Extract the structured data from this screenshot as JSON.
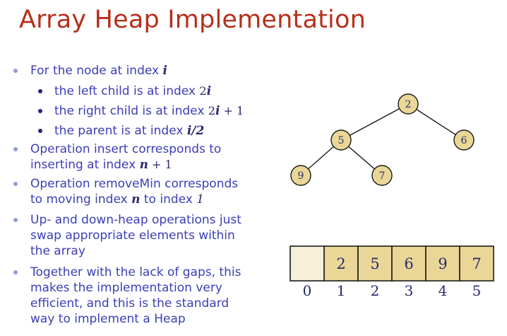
{
  "title": "Array Heap Implementation",
  "bullets": {
    "b1": {
      "text": "For the node at index ",
      "var": "i"
    },
    "sub1": {
      "text": "the left child is at index ",
      "expr": "2",
      "var": "i"
    },
    "sub2": {
      "text": "the right child is at index ",
      "expr": "2",
      "var": "i",
      "tail": " + 1"
    },
    "sub3": {
      "text": "the parent is at index ",
      "var": "i/2"
    },
    "b2_l1": "Operation insert corresponds to",
    "b2_l2": {
      "text": "inserting at index ",
      "var": "n",
      "tail": " + 1"
    },
    "b3_l1": "Operation removeMin corresponds",
    "b3_l2": {
      "text": "to  moving index ",
      "var": "n",
      "mid": " to index ",
      "num": "1"
    },
    "b4_l1": "Up- and down-heap operations just",
    "b4_l2": "swap appropriate elements within",
    "b4_l3": "the array",
    "b5_l1": "Together with the lack of gaps, this",
    "b5_l2": "makes the implementation very",
    "b5_l3": "efficient, and this is the standard",
    "b5_l4": "way to implement a Heap"
  },
  "tree": {
    "nodes": [
      {
        "id": "root",
        "label": "2"
      },
      {
        "id": "left",
        "label": "5"
      },
      {
        "id": "right",
        "label": "6"
      },
      {
        "id": "left-left",
        "label": "9"
      },
      {
        "id": "left-right",
        "label": "7"
      }
    ]
  },
  "array": {
    "cells": [
      "",
      "2",
      "5",
      "6",
      "9",
      "7"
    ],
    "indices": [
      "0",
      "1",
      "2",
      "3",
      "4",
      "5"
    ]
  },
  "colors": {
    "title": "#b5301a",
    "text": "#3d3db8",
    "node_fill": "#ead797",
    "cell_fill": "#ead797",
    "empty_cell_fill": "#f7f0d9"
  }
}
